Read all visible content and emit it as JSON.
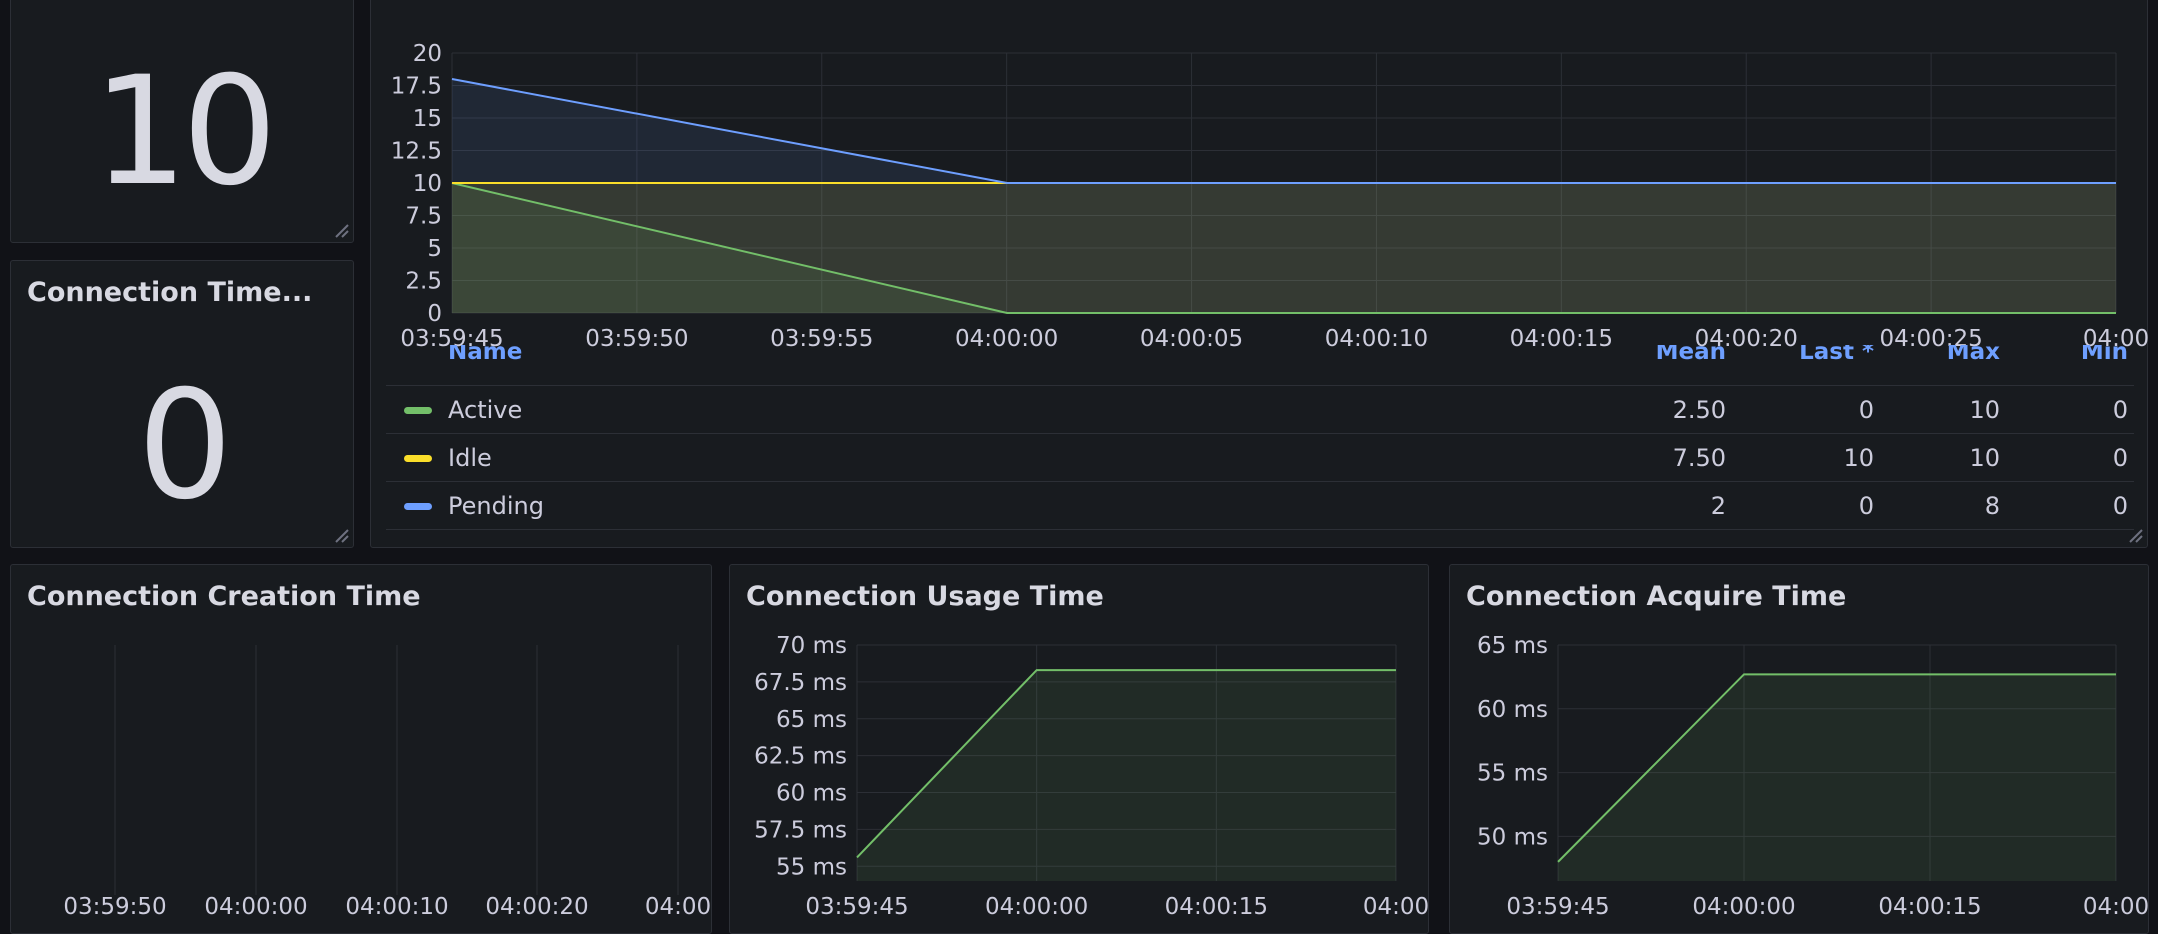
{
  "colors": {
    "active": "#73bf69",
    "idle": "#fade2a",
    "pending": "#6e9fff",
    "grid": "#2c2f36",
    "text": "#ccccdc"
  },
  "stat_top": {
    "value": "10"
  },
  "stat_conn_time": {
    "title": "Connection Time...",
    "value": "0"
  },
  "main_chart": {
    "legend_headers": {
      "name": "Name",
      "mean": "Mean",
      "last": "Last *",
      "max": "Max",
      "min": "Min"
    },
    "legend_rows": [
      {
        "name": "Active",
        "mean": "2.50",
        "last": "0",
        "max": "10",
        "min": "0"
      },
      {
        "name": "Idle",
        "mean": "7.50",
        "last": "10",
        "max": "10",
        "min": "0"
      },
      {
        "name": "Pending",
        "mean": "2",
        "last": "0",
        "max": "8",
        "min": "0"
      }
    ]
  },
  "creation_panel": {
    "title": "Connection Creation Time"
  },
  "usage_panel": {
    "title": "Connection Usage Time"
  },
  "acquire_panel": {
    "title": "Connection Acquire Time"
  },
  "chart_data": [
    {
      "type": "area",
      "x": [
        "03:59:45",
        "04:00:00",
        "04:00:30"
      ],
      "xticks": [
        "03:59:45",
        "03:59:50",
        "03:59:55",
        "04:00:00",
        "04:00:05",
        "04:00:10",
        "04:00:15",
        "04:00:20",
        "04:00:25",
        "04:00"
      ],
      "yticks": [
        "0",
        "2.5",
        "5",
        "7.5",
        "10",
        "12.5",
        "15",
        "17.5",
        "20"
      ],
      "ylim": [
        0,
        20
      ],
      "series": [
        {
          "name": "Active",
          "values": [
            10,
            0,
            0
          ]
        },
        {
          "name": "Idle",
          "values": [
            10,
            10,
            10
          ]
        },
        {
          "name": "Pending",
          "values": [
            18,
            10,
            10
          ]
        }
      ]
    },
    {
      "type": "line",
      "title": "Connection Creation Time",
      "xticks": [
        "03:59:50",
        "04:00:00",
        "04:00:10",
        "04:00:20",
        "04:00"
      ],
      "series": []
    },
    {
      "type": "area",
      "title": "Connection Usage Time",
      "x": [
        "03:59:45",
        "04:00:00",
        "04:00:15"
      ],
      "xticks": [
        "03:59:45",
        "04:00:00",
        "04:00:15",
        "04:00"
      ],
      "yticks": [
        "55 ms",
        "57.5 ms",
        "60 ms",
        "62.5 ms",
        "65 ms",
        "67.5 ms",
        "70 ms"
      ],
      "ylim": [
        54,
        70
      ],
      "series": [
        {
          "values": [
            55.6,
            68.3,
            68.3
          ]
        }
      ]
    },
    {
      "type": "area",
      "title": "Connection Acquire Time",
      "x": [
        "03:59:45",
        "04:00:00",
        "04:00:15"
      ],
      "xticks": [
        "03:59:45",
        "04:00:00",
        "04:00:15",
        "04:00"
      ],
      "yticks": [
        "50 ms",
        "55 ms",
        "60 ms",
        "65 ms"
      ],
      "ylim": [
        46.5,
        65
      ],
      "series": [
        {
          "values": [
            48,
            62.7,
            62.7
          ]
        }
      ]
    }
  ]
}
